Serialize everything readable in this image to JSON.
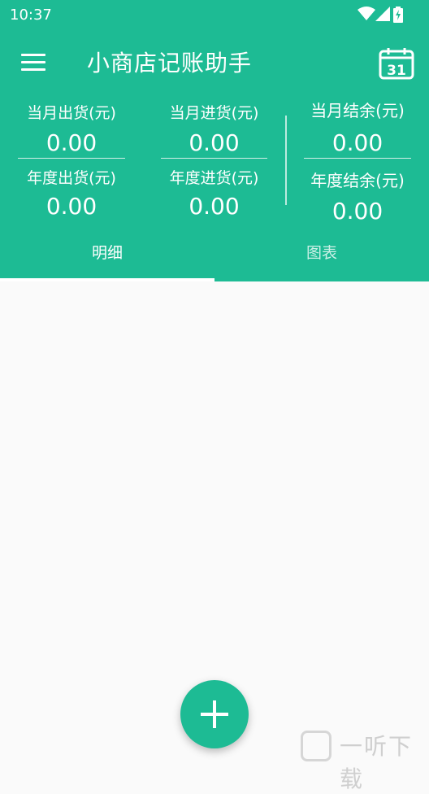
{
  "status_bar": {
    "time": "10:37"
  },
  "toolbar": {
    "title": "小商店记账助手",
    "calendar_day": "31"
  },
  "summary": {
    "month_out_label": "当月出货(元)",
    "month_out_value": "0.00",
    "month_in_label": "当月进货(元)",
    "month_in_value": "0.00",
    "month_balance_label": "当月结余(元)",
    "month_balance_value": "0.00",
    "year_out_label": "年度出货(元)",
    "year_out_value": "0.00",
    "year_in_label": "年度进货(元)",
    "year_in_value": "0.00",
    "year_balance_label": "年度结余(元)",
    "year_balance_value": "0.00"
  },
  "tabs": [
    {
      "label": "明细",
      "selected": true
    },
    {
      "label": "图表",
      "selected": false
    }
  ],
  "watermark": {
    "text": "一听下载"
  },
  "colors": {
    "accent": "#1dbb94",
    "background": "#fafafa"
  }
}
